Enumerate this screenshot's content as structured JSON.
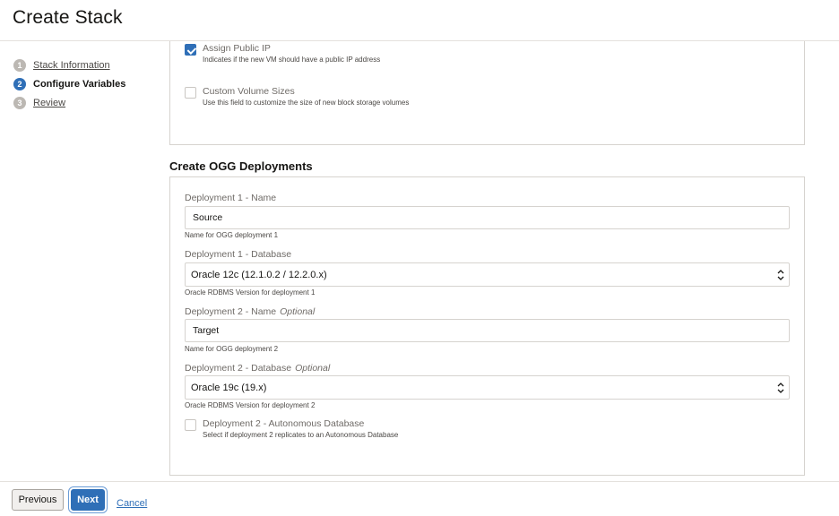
{
  "page": {
    "title": "Create Stack"
  },
  "steps": [
    {
      "num": "1",
      "label": "Stack Information",
      "active": false
    },
    {
      "num": "2",
      "label": "Configure Variables",
      "active": true
    },
    {
      "num": "3",
      "label": "Review",
      "active": false
    }
  ],
  "top_options": {
    "assign_public_ip": {
      "label": "Assign Public IP",
      "help": "Indicates if the new VM should have a public IP address",
      "checked": true
    },
    "custom_volume_sizes": {
      "label": "Custom Volume Sizes",
      "help": "Use this field to customize the size of new block storage volumes",
      "checked": false
    }
  },
  "ogg": {
    "title": "Create OGG Deployments",
    "dep1_name": {
      "label": "Deployment 1 - Name",
      "value": "Source",
      "help": "Name for OGG deployment 1"
    },
    "dep1_db": {
      "label": "Deployment 1 - Database",
      "value": "Oracle 12c (12.1.0.2 / 12.2.0.x)",
      "help": "Oracle RDBMS Version for deployment 1"
    },
    "dep2_name": {
      "label": "Deployment 2 - Name",
      "optional": "Optional",
      "value": "Target",
      "help": "Name for OGG deployment 2"
    },
    "dep2_db": {
      "label": "Deployment 2 - Database",
      "optional": "Optional",
      "value": "Oracle 19c (19.x)",
      "help": "Oracle RDBMS Version for deployment 2"
    },
    "dep2_autonomous": {
      "label": "Deployment 2 - Autonomous Database",
      "help": "Select if deployment 2 replicates to an Autonomous Database",
      "checked": false
    }
  },
  "footer": {
    "previous": "Previous",
    "next": "Next",
    "cancel": "Cancel"
  },
  "colors": {
    "accent": "#2f6fb7",
    "border": "#d6d3cf",
    "text": "#161513",
    "muted": "#6f6b67"
  }
}
